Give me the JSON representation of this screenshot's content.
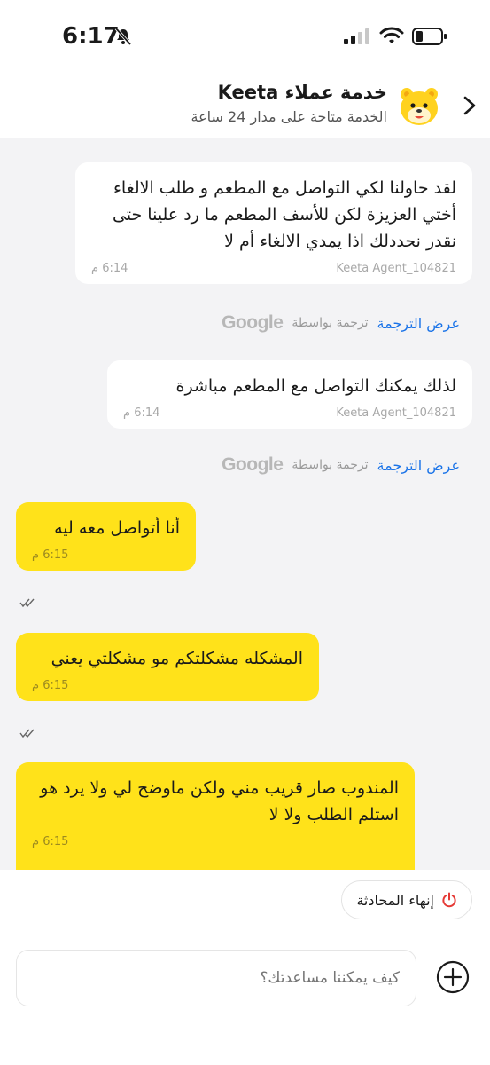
{
  "status_bar": {
    "time": "6:17"
  },
  "header": {
    "title": "خدمة عملاء Keeta",
    "subtitle": "الخدمة متاحة على مدار 24 ساعة"
  },
  "messages": [
    {
      "sender": "agent",
      "text": "لقد حاولنا لكي التواصل مع المطعم و طلب الالغاء أختي العزيزة لكن للأسف المطعم ما رد علينا حتى نقدر نحددلك اذا يمدي الالغاء أم لا",
      "agent_name": "Keeta Agent_104821",
      "time": "6:14 م",
      "translate_label": "عرض الترجمة",
      "translated_by": "ترجمة بواسطة",
      "translator": "Google"
    },
    {
      "sender": "agent",
      "text": "لذلك يمكنك التواصل مع المطعم مباشرة",
      "agent_name": "Keeta Agent_104821",
      "time": "6:14 م",
      "translate_label": "عرض الترجمة",
      "translated_by": "ترجمة بواسطة",
      "translator": "Google"
    },
    {
      "sender": "me",
      "text": "أنا أتواصل معه ليه",
      "time": "6:15 م"
    },
    {
      "sender": "me",
      "text": "المشكله مشكلتكم مو مشكلتي يعني",
      "time": "6:15 م"
    },
    {
      "sender": "me",
      "text": "المندوب صار قريب مني ولكن ماوضح لي ولا يرد هو استلم الطلب ولا لا",
      "time": "6:15 م"
    }
  ],
  "end_chat": {
    "label": "إنهاء المحادثة"
  },
  "composer": {
    "placeholder": "كيف يمكننا مساعدتك؟"
  },
  "colors": {
    "my_bubble": "#ffe21a",
    "link": "#1a73e8",
    "end_icon": "#e53935"
  }
}
